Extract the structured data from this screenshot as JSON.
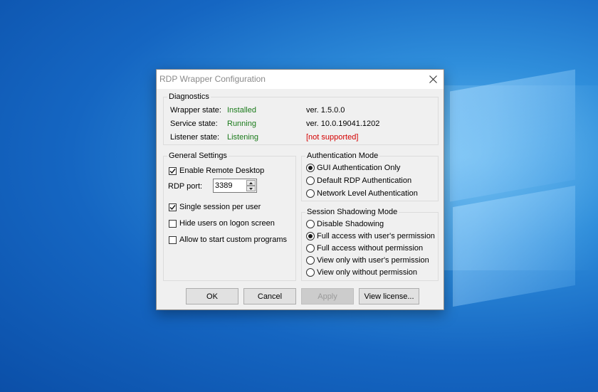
{
  "window": {
    "title": "RDP Wrapper Configuration"
  },
  "diagnostics": {
    "legend": "Diagnostics",
    "wrapper": {
      "label": "Wrapper state:",
      "status": "Installed",
      "version": "ver.  1.5.0.0"
    },
    "service": {
      "label": "Service state:",
      "status": "Running",
      "version": "ver.  10.0.19041.1202"
    },
    "listener": {
      "label": "Listener state:",
      "status": "Listening",
      "version": "[not supported]"
    }
  },
  "general": {
    "legend": "General Settings",
    "enable_remote_desktop": {
      "label": "Enable Remote Desktop",
      "checked": true
    },
    "rdp_port": {
      "label": "RDP port:",
      "value": "3389"
    },
    "single_session": {
      "label": "Single session per user",
      "checked": true
    },
    "hide_users": {
      "label": "Hide users on logon screen",
      "checked": false
    },
    "custom_programs": {
      "label": "Allow to start custom programs",
      "checked": false
    }
  },
  "auth": {
    "legend": "Authentication Mode",
    "options": [
      {
        "label": "GUI Authentication Only",
        "selected": true
      },
      {
        "label": "Default RDP Authentication",
        "selected": false
      },
      {
        "label": "Network Level Authentication",
        "selected": false
      }
    ]
  },
  "shadow": {
    "legend": "Session Shadowing Mode",
    "options": [
      {
        "label": "Disable Shadowing",
        "selected": false
      },
      {
        "label": "Full access with user's permission",
        "selected": true
      },
      {
        "label": "Full access without permission",
        "selected": false
      },
      {
        "label": "View only with user's permission",
        "selected": false
      },
      {
        "label": "View only without permission",
        "selected": false
      }
    ]
  },
  "buttons": {
    "ok": "OK",
    "cancel": "Cancel",
    "apply": "Apply",
    "license": "View license..."
  },
  "colors": {
    "ok_status": "#1a7a1a",
    "error_status": "#d40000",
    "desktop": "#1566c2"
  },
  "icons": {
    "close": "close-icon",
    "checkmark": "checkmark-icon",
    "spin_up": "arrow-up-icon",
    "spin_down": "arrow-down-icon"
  }
}
